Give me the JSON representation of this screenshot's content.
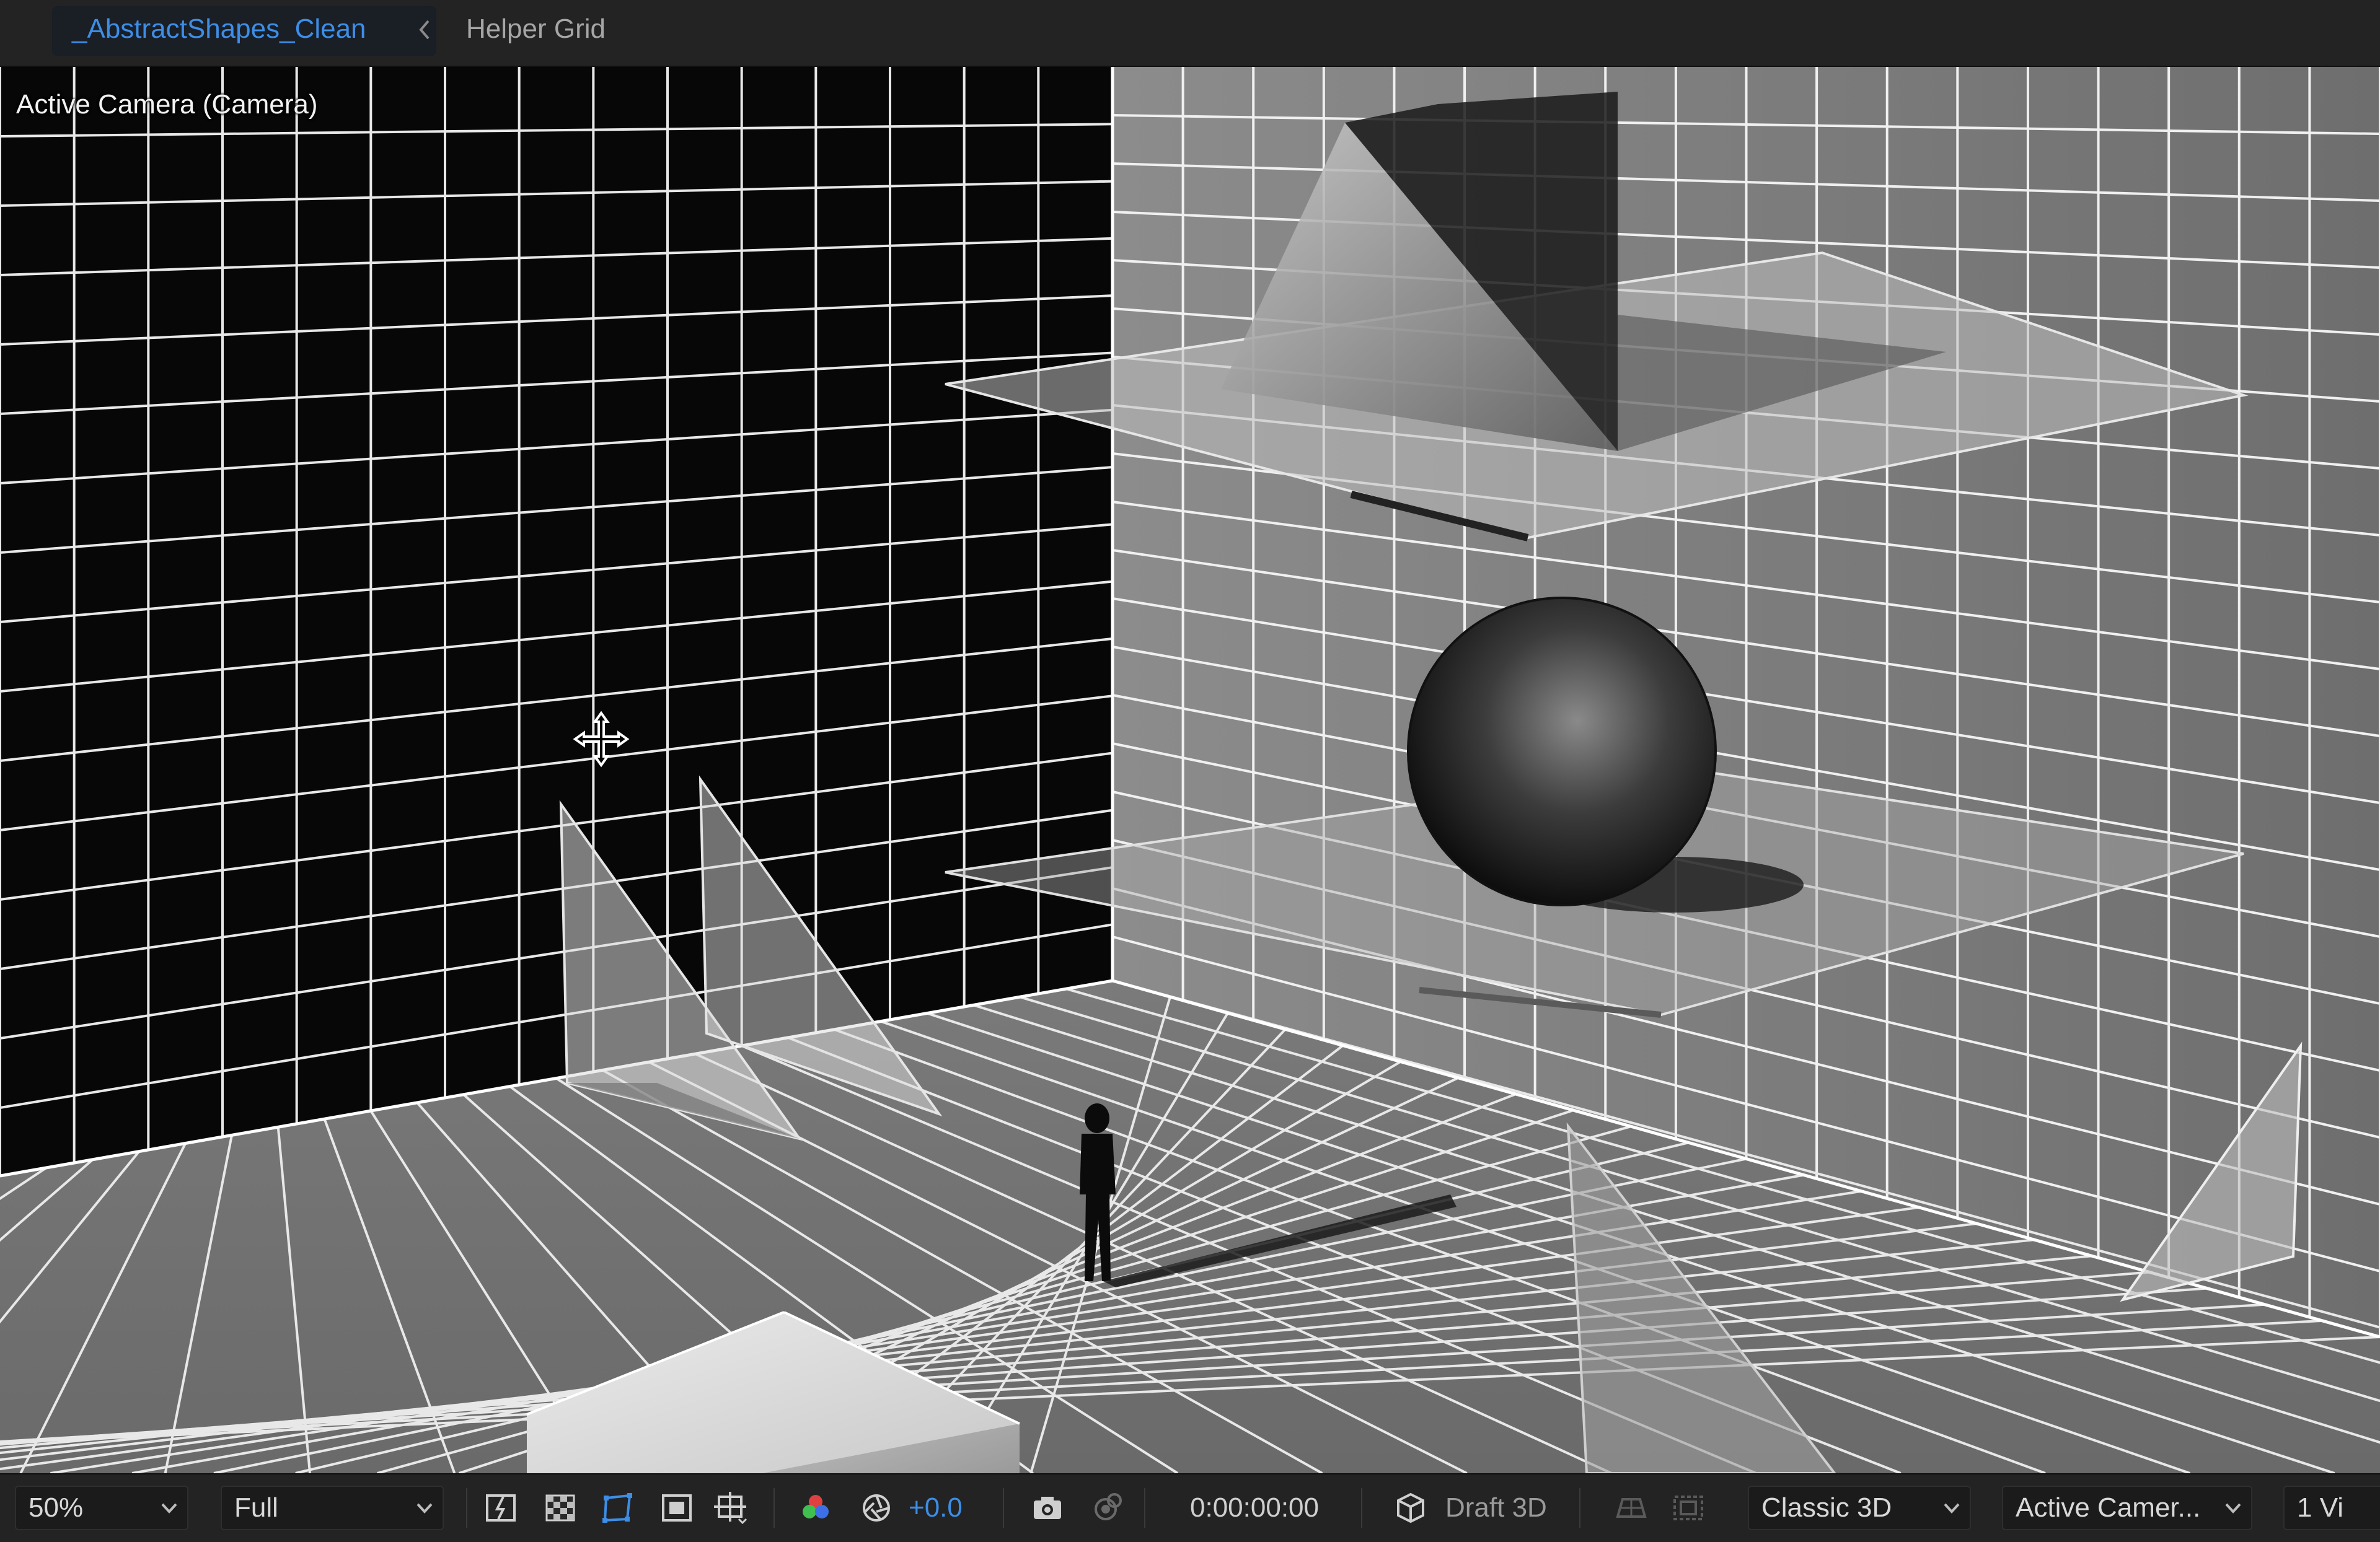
{
  "tabs": {
    "active_label": "_AbstractShapes_Clean",
    "secondary_label": "Helper Grid"
  },
  "viewer": {
    "view_label": "Active Camera (Camera)"
  },
  "toolbar": {
    "magnification": "50%",
    "resolution": "Full",
    "exposure": "+0.0",
    "timecode": "0:00:00:00",
    "draft_3d": "Draft 3D",
    "renderer": "Classic 3D",
    "view": "Active Camer...",
    "layout": "1 Vi",
    "accent_color": "#3d8ee6"
  },
  "icons": [
    "chevron-left-icon",
    "move-cursor-icon",
    "fast-previews-icon",
    "transparency-grid-icon",
    "mask-path-icon",
    "region-of-interest-icon",
    "grid-guides-icon",
    "channel-icon",
    "exposure-reset-icon",
    "snapshot-icon",
    "show-snapshot-icon",
    "draft-3d-icon",
    "3d-ground-plane-icon",
    "extended-viewer-icon",
    "chevron-down-icon"
  ]
}
